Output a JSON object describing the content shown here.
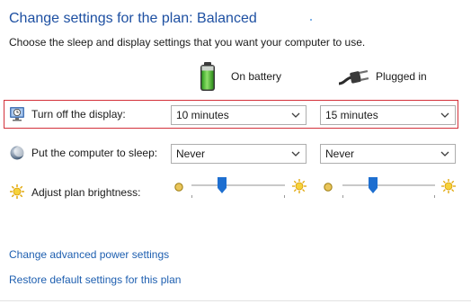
{
  "header": {
    "title": "Change settings for the plan: Balanced",
    "subtitle": "Choose the sleep and display settings that you want your computer to use."
  },
  "columns": {
    "battery_label": "On battery",
    "plugged_label": "Plugged in"
  },
  "rows": {
    "display": {
      "label": "Turn off the display:",
      "battery_value": "10 minutes",
      "plugged_value": "15 minutes"
    },
    "sleep": {
      "label": "Put the computer to sleep:",
      "battery_value": "Never",
      "plugged_value": "Never"
    },
    "brightness": {
      "label": "Adjust plan brightness:",
      "battery_level": 0.33,
      "plugged_level": 0.33
    }
  },
  "links": {
    "advanced": "Change advanced power settings",
    "restore": "Restore default settings for this plan"
  },
  "colors": {
    "title": "#1e50a2",
    "link": "#1e5fb0",
    "highlight": "#d3313a",
    "slider_thumb": "#1e6fd0"
  },
  "icons": {
    "battery": "battery-icon",
    "plug": "power-plug-icon",
    "display": "display-clock-icon",
    "sleep": "moon-icon",
    "brightness": "sun-icon"
  }
}
